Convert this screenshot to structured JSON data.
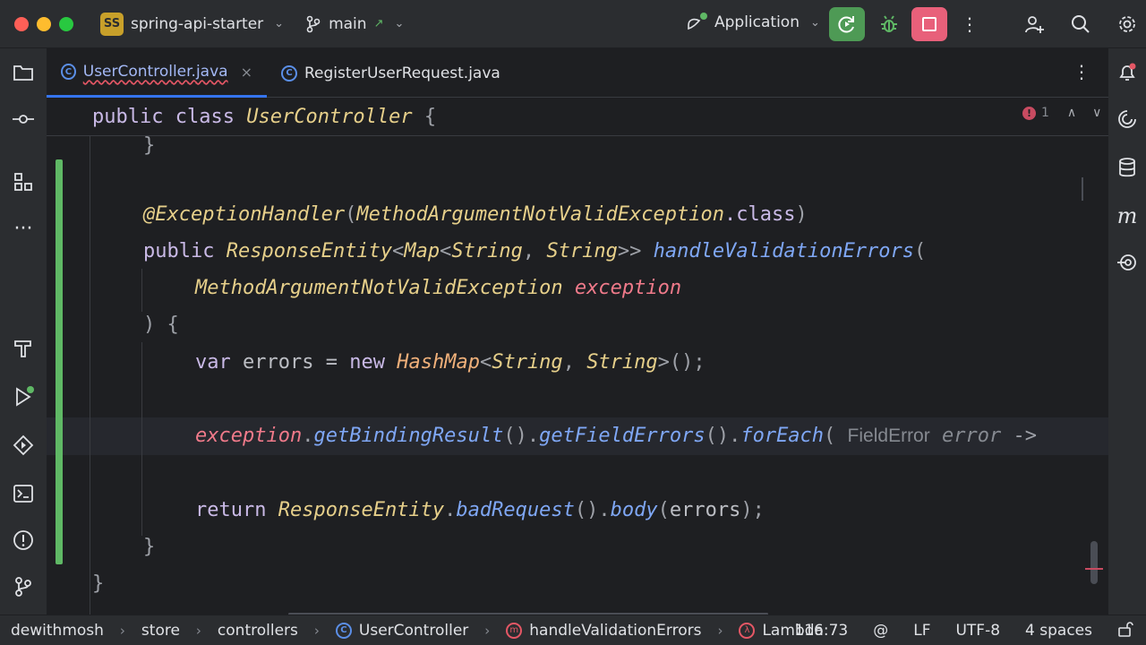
{
  "titlebar": {
    "project_badge": "SS",
    "project_name": "spring-api-starter",
    "branch": "main",
    "run_config": "Application"
  },
  "tabs": [
    {
      "label": "UserController.java",
      "active": true
    },
    {
      "label": "RegisterUserRequest.java",
      "active": false
    }
  ],
  "editor": {
    "sticky_header": {
      "kw": "public",
      "kw2": "class",
      "name": "UserController",
      "brace": "{"
    },
    "inspection": {
      "error_count": "1"
    },
    "lines": {
      "closing_prev": "}",
      "annotation": "@ExceptionHandler",
      "annotation_open": "(",
      "annotation_arg": "MethodArgumentNotValidException",
      "annotation_class": ".class",
      "annotation_close": ")",
      "sig_public": "public",
      "sig_type1": "ResponseEntity",
      "sig_lt1": "<",
      "sig_type2": "Map",
      "sig_lt2": "<",
      "sig_type3": "String",
      "sig_comma": ", ",
      "sig_type4": "String",
      "sig_gt": ">>",
      "sig_method": "handleValidationErrors",
      "sig_paren": "(",
      "param_type": "MethodArgumentNotValidException",
      "param_name": "exception",
      "close_paren": ")",
      "open_brace": "{",
      "var_kw": "var",
      "var_name": "errors",
      "var_eq": "=",
      "new_kw": "new",
      "hashmap": "HashMap",
      "hm_lt": "<",
      "hm_t1": "String",
      "hm_comma": ", ",
      "hm_t2": "String",
      "hm_end": ">();",
      "call_recv": "exception",
      "call_dot1": ".",
      "call_m1": "getBindingResult",
      "call_p1": "().",
      "call_m2": "getFieldErrors",
      "call_p2": "().",
      "call_m3": "forEach",
      "call_p3": "(",
      "hint_type": "FieldError",
      "hint_param": "error",
      "hint_arrow": "->",
      "ret_kw": "return",
      "ret_type": "ResponseEntity",
      "ret_dot": ".",
      "ret_m1": "badRequest",
      "ret_p1": "().",
      "ret_m2": "body",
      "ret_p2": "(",
      "ret_arg": "errors",
      "ret_end": ");",
      "method_close": "}",
      "class_close": "}"
    }
  },
  "statusbar": {
    "breadcrumbs": [
      "dewithmosh",
      "store",
      "controllers",
      "UserController",
      "handleValidationErrors",
      "Lambda"
    ],
    "position": "116:73",
    "line_sep": "LF",
    "encoding": "UTF-8",
    "indent": "4 spaces"
  },
  "colors": {
    "accent": "#3574f0",
    "run_green": "#4e9a55",
    "stop_pink": "#e8607a",
    "change_bar": "#5fb865"
  }
}
